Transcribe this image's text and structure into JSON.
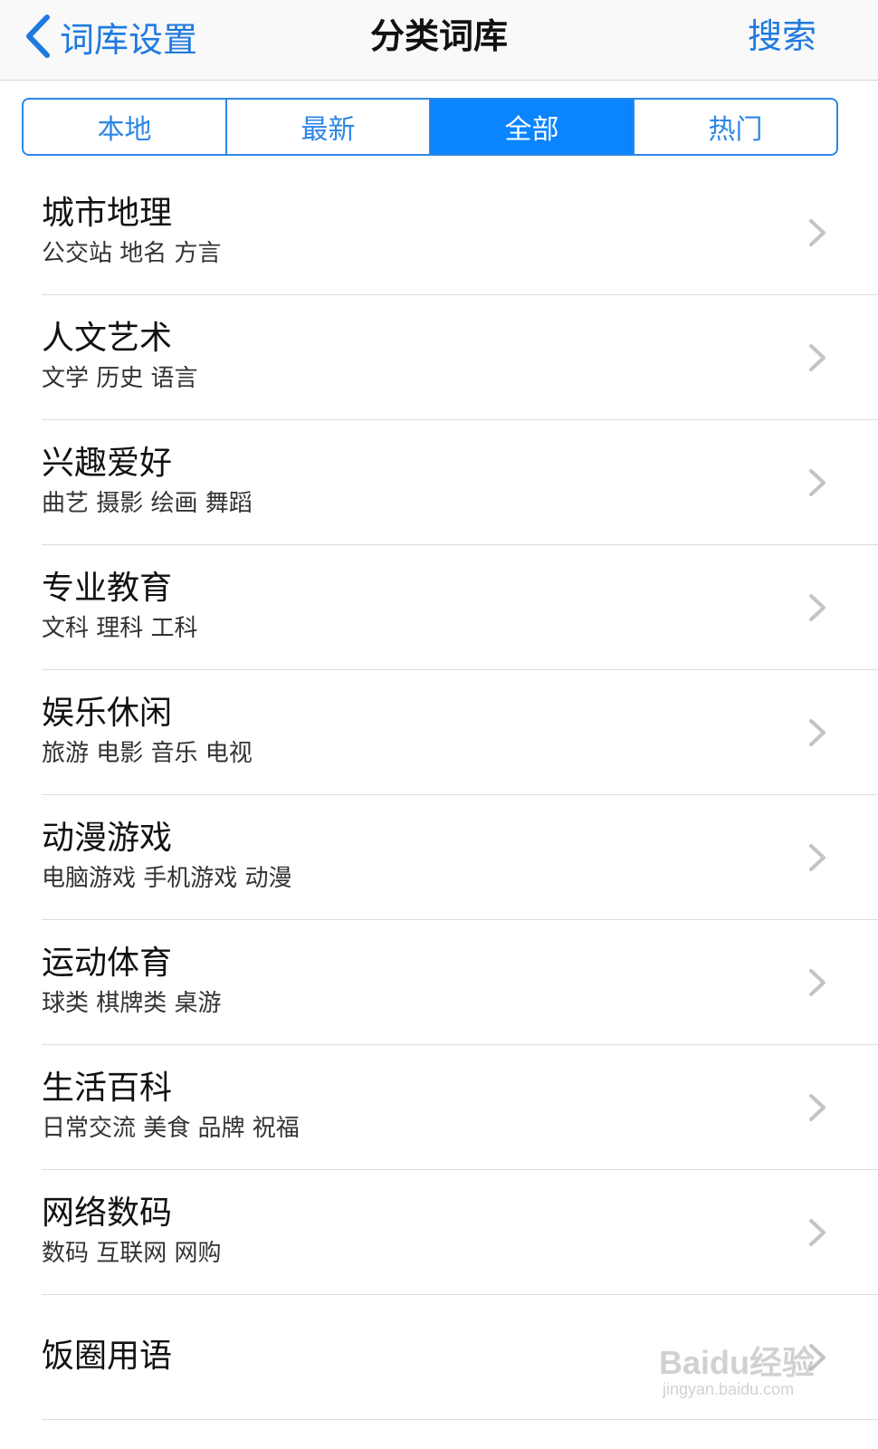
{
  "navbar": {
    "back_label": "词库设置",
    "title": "分类词库",
    "search_label": "搜索"
  },
  "tabs": [
    {
      "label": "本地",
      "active": false
    },
    {
      "label": "最新",
      "active": false
    },
    {
      "label": "全部",
      "active": true
    },
    {
      "label": "热门",
      "active": false
    }
  ],
  "categories": [
    {
      "title": "城市地理",
      "subtitle": "公交站 地名 方言"
    },
    {
      "title": "人文艺术",
      "subtitle": "文学 历史 语言"
    },
    {
      "title": "兴趣爱好",
      "subtitle": "曲艺 摄影 绘画 舞蹈"
    },
    {
      "title": "专业教育",
      "subtitle": "文科 理科 工科"
    },
    {
      "title": "娱乐休闲",
      "subtitle": "旅游 电影 音乐 电视"
    },
    {
      "title": "动漫游戏",
      "subtitle": "电脑游戏 手机游戏 动漫"
    },
    {
      "title": "运动体育",
      "subtitle": "球类 棋牌类 桌游"
    },
    {
      "title": "生活百科",
      "subtitle": "日常交流 美食 品牌 祝福"
    },
    {
      "title": "网络数码",
      "subtitle": "数码 互联网 网购"
    },
    {
      "title": "饭圈用语",
      "subtitle": ""
    }
  ],
  "watermark": {
    "main": "Baidu经验",
    "sub": "jingyan.baidu.com"
  },
  "colors": {
    "accent": "#1f7ae0",
    "segment_active": "#0a84ff"
  }
}
